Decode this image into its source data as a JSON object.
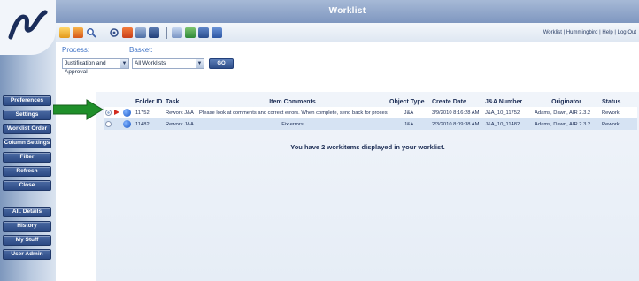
{
  "window": {
    "title": "Worklist"
  },
  "top_links": {
    "text": "Worklist | Hummingbird | Help | Log Out"
  },
  "toolbar": {
    "icons": [
      "folder-icon",
      "new-folder-icon",
      "search-icon",
      "settings-icon",
      "inbox-icon",
      "calendar-icon",
      "print-icon",
      "edit-icon",
      "tree-icon",
      "table-icon",
      "report-icon"
    ]
  },
  "filters": {
    "process_label": "Process:",
    "process_value": "Justification and Approval",
    "basket_label": "Basket:",
    "basket_value": "All Worklists",
    "go_label": "GO"
  },
  "sidebar": {
    "items": [
      {
        "label": "Preferences"
      },
      {
        "label": "Settings"
      },
      {
        "label": "Worklist Order"
      },
      {
        "label": "Column Settings"
      },
      {
        "label": "Filter"
      },
      {
        "label": "Refresh"
      },
      {
        "label": "Close"
      },
      {
        "label": "All. Details"
      },
      {
        "label": "History"
      },
      {
        "label": "My Stuff"
      },
      {
        "label": "User Admin"
      }
    ]
  },
  "table": {
    "headers": [
      "",
      "",
      "",
      "Folder ID",
      "Task",
      "Item Comments",
      "Object Type",
      "Create Date",
      "J&A Number",
      "Originator",
      "Status"
    ],
    "rows": [
      {
        "folder_id": "11752",
        "task": "Rework J&A",
        "comments": "Please look at comments and correct errors. When complete, send back for processing.",
        "object_type": "J&A",
        "create_date": "3/9/2010 8:16:28 AM",
        "ja_number": "J&A_10_11752",
        "originator": "Adams, Dawn, AIR 2.3.2",
        "status": "Rework"
      },
      {
        "folder_id": "11482",
        "task": "Rework J&A",
        "comments": "Fix errors",
        "object_type": "J&A",
        "create_date": "2/3/2010 8:09:38 AM",
        "ja_number": "J&A_10_11482",
        "originator": "Adams, Dawn, AIR 2.3.2",
        "status": "Rework"
      }
    ]
  },
  "summary": {
    "text": "You have 2 workitems displayed in your worklist."
  },
  "colors": {
    "sidebar_button": "#2c4a84",
    "title_bar": "#7f97c0",
    "label_blue": "#3f73c7",
    "arrow_green": "#1f8f2a",
    "play_red": "#d22b1f"
  }
}
